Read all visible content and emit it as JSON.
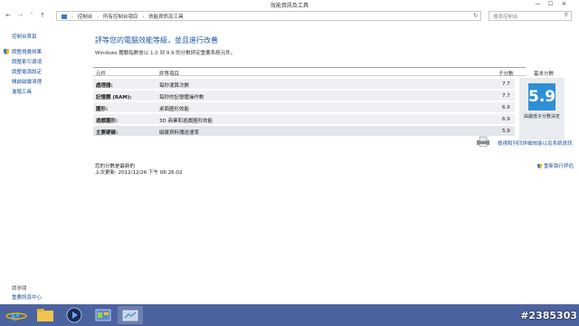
{
  "window": {
    "title": "效能資訊及工具",
    "min_label": "—",
    "max_label": "☐",
    "close_label": "✕"
  },
  "nav": {
    "back": "←",
    "forward": "→",
    "recent": "˅",
    "up": "↑"
  },
  "address": {
    "crumbs": [
      "控制台",
      "所有控制台項目",
      "效能資訊及工具"
    ],
    "refresh_label": "↻"
  },
  "search": {
    "placeholder": "搜尋控制台"
  },
  "sidebar": {
    "home": "控制台首頁",
    "items": [
      {
        "label": "調整視覺效果"
      },
      {
        "label": "調整索引選項"
      },
      {
        "label": "調整電源設定"
      },
      {
        "label": "開啟磁碟清理"
      },
      {
        "label": "進階工具"
      }
    ],
    "see_also_title": "請參閱",
    "see_also_items": [
      {
        "label": "重要訊息中心"
      }
    ]
  },
  "main": {
    "heading": "評等您的電腦效能等級，並且進行改善",
    "subtext": "Windows 體驗指數會以 1.0 到 9.9 的分數評定重要系統元件。",
    "table": {
      "headers": [
        "元件",
        "評等項目",
        "子分數",
        "基本分數"
      ],
      "rows": [
        {
          "component": "處理器:",
          "rated": "每秒運算次數",
          "score": "7.7"
        },
        {
          "component": "記憶體 (RAM):",
          "rated": "每秒的記憶體操作數",
          "score": "7.7"
        },
        {
          "component": "圖形:",
          "rated": "桌面圖形效能",
          "score": "6.9"
        },
        {
          "component": "遊戲圖形:",
          "rated": "3D 商業和遊戲圖形效能",
          "score": "6.9"
        },
        {
          "component": "主要硬碟:",
          "rated": "磁碟資料傳送速率",
          "score": "5.9"
        }
      ]
    },
    "base_score": "5.9",
    "base_caption": "由最低子分數決定",
    "print_link": "檢視和列印詳細效能以及系統資訊",
    "rerun_link": "重新執行評估",
    "current_status": "您的分數是最新的",
    "last_update": "上次更新: 2012/12/26 下午 06:26:02"
  },
  "watermark": "#2385303",
  "colors": {
    "taskbar": "#4d63a0",
    "link": "#1b4f9b",
    "heading": "#1e5aa8",
    "score_tile": "#2f8fd6"
  }
}
